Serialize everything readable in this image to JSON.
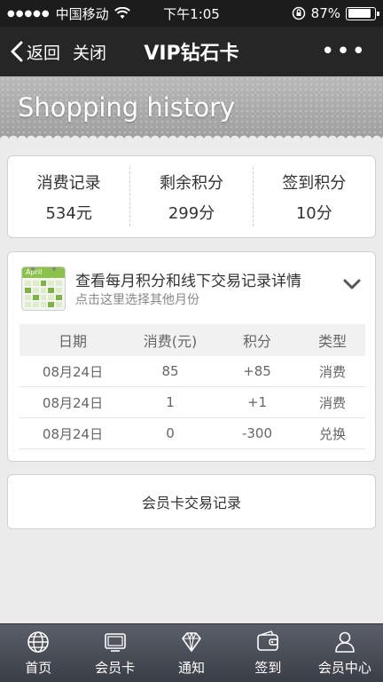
{
  "status_bar": {
    "carrier": "中国移动",
    "time": "下午1:05",
    "battery_percent": "87%",
    "battery_level": 0.87
  },
  "nav": {
    "back_label": "返回",
    "close_label": "关闭",
    "title": "VIP钻石卡",
    "more_label": "•••"
  },
  "banner": {
    "title": "Shopping history"
  },
  "summary": {
    "items": [
      {
        "label": "消费记录",
        "value": "534元"
      },
      {
        "label": "剩余积分",
        "value": "299分"
      },
      {
        "label": "签到积分",
        "value": "10分"
      }
    ]
  },
  "history": {
    "calendar_label": "April",
    "title": "查看每月积分和线下交易记录详情",
    "subtitle": "点击这里选择其他月份",
    "headers": [
      "日期",
      "消费(元)",
      "积分",
      "类型"
    ],
    "rows": [
      {
        "date": "08月24日",
        "amount": "85",
        "points": "+85",
        "type": "消费"
      },
      {
        "date": "08月24日",
        "amount": "1",
        "points": "+1",
        "type": "消费"
      },
      {
        "date": "08月24日",
        "amount": "0",
        "points": "-300",
        "type": "兑换"
      }
    ]
  },
  "member_record": {
    "label": "会员卡交易记录"
  },
  "tab_bar": {
    "items": [
      {
        "label": "首页",
        "icon": "globe-icon"
      },
      {
        "label": "会员卡",
        "icon": "card-icon"
      },
      {
        "label": "通知",
        "icon": "diamond-icon"
      },
      {
        "label": "签到",
        "icon": "wallet-icon"
      },
      {
        "label": "会员中心",
        "icon": "user-icon"
      }
    ]
  },
  "colors": {
    "nav_bg": "#262626",
    "tab_bg": "#4a4e57",
    "calendar_green": "#7cb342"
  }
}
